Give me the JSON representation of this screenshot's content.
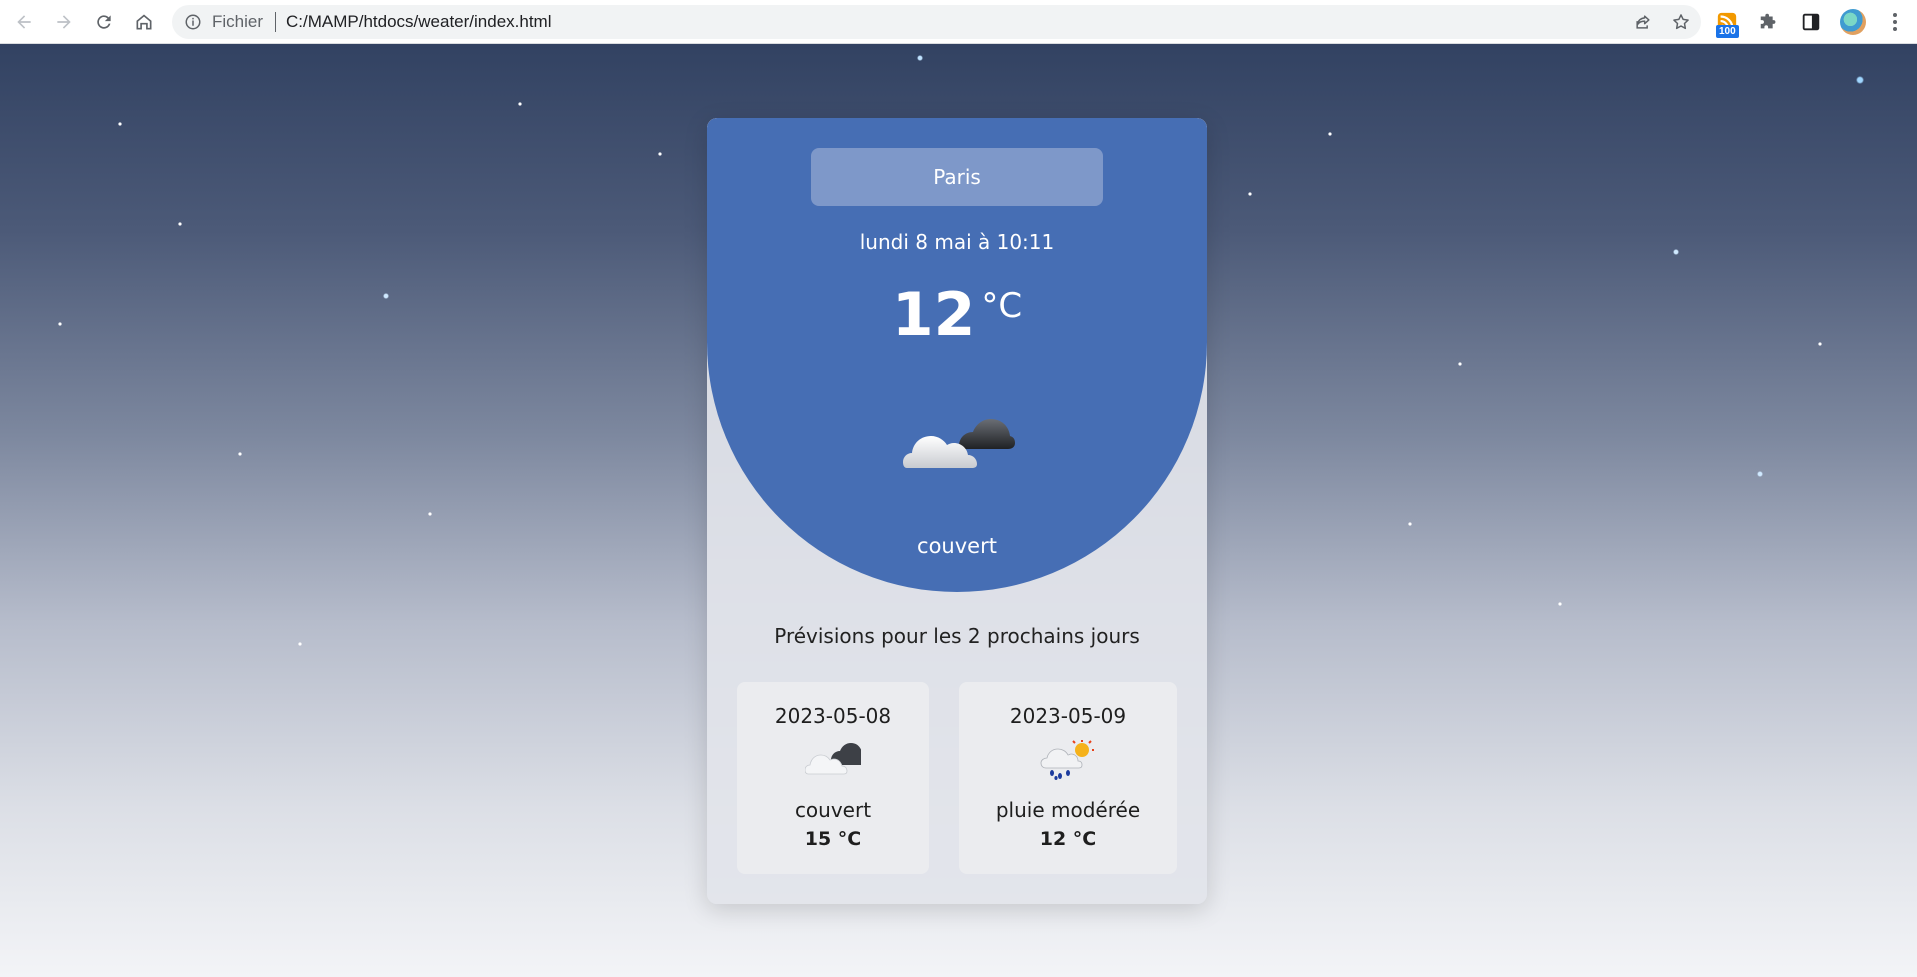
{
  "browser": {
    "site_label": "Fichier",
    "url": "C:/MAMP/htdocs/weater/index.html",
    "extension_badge": "100"
  },
  "weather": {
    "city": "Paris",
    "datetime": "lundi 8 mai à 10:11",
    "temperature": "12",
    "unit": "°C",
    "condition": "couvert",
    "condition_icon": "overcast-cloud-icon",
    "colors": {
      "panel": "#466eb4",
      "city_box": "#7e98c9"
    }
  },
  "forecast": {
    "title": "Prévisions pour les 2 prochains jours",
    "days": [
      {
        "date": "2023-05-08",
        "icon": "overcast-cloud-icon",
        "condition": "couvert",
        "temperature": "15 °C"
      },
      {
        "date": "2023-05-09",
        "icon": "rain-sun-icon",
        "condition": "pluie modérée",
        "temperature": "12 °C"
      }
    ]
  }
}
